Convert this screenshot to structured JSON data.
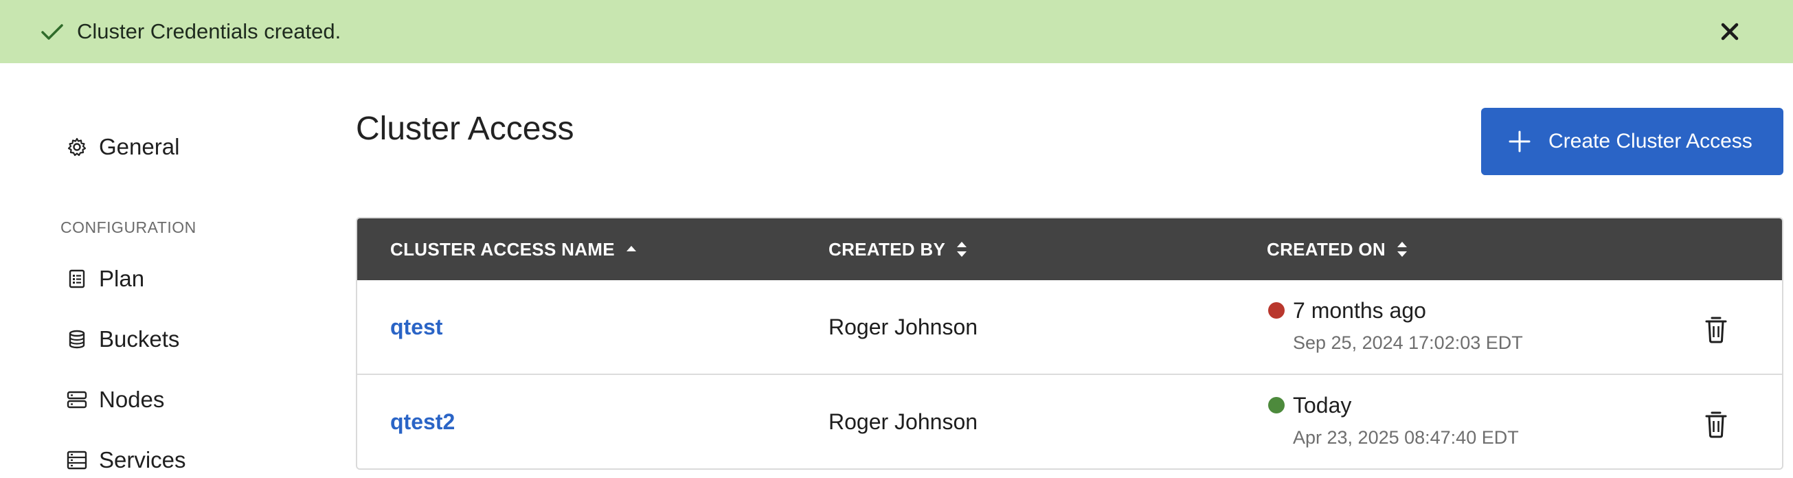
{
  "toast": {
    "message": "Cluster Credentials created.",
    "color": "#c8e6b0",
    "check_icon": "check-icon",
    "close_icon": "close-icon"
  },
  "sidebar": {
    "general_label": "General",
    "section_heading": "CONFIGURATION",
    "items": [
      {
        "label": "Plan",
        "icon": "plan-icon"
      },
      {
        "label": "Buckets",
        "icon": "database-icon"
      },
      {
        "label": "Nodes",
        "icon": "nodes-icon"
      },
      {
        "label": "Services",
        "icon": "services-icon"
      }
    ]
  },
  "main": {
    "title": "Cluster Access",
    "create_button_label": "Create Cluster Access",
    "accent_color": "#2a64c6"
  },
  "table": {
    "columns": [
      {
        "label": "CLUSTER ACCESS NAME",
        "sort": "ascending"
      },
      {
        "label": "CREATED BY",
        "sort": "none"
      },
      {
        "label": "CREATED ON",
        "sort": "none"
      }
    ],
    "rows": [
      {
        "name": "qtest",
        "created_by": "Roger Johnson",
        "created_relative": "7 months ago",
        "created_absolute": "Sep 25, 2024 17:02:03 EDT",
        "status_color": "#b9372d"
      },
      {
        "name": "qtest2",
        "created_by": "Roger Johnson",
        "created_relative": "Today",
        "created_absolute": "Apr 23, 2025 08:47:40 EDT",
        "status_color": "#4d8a3c"
      }
    ]
  }
}
